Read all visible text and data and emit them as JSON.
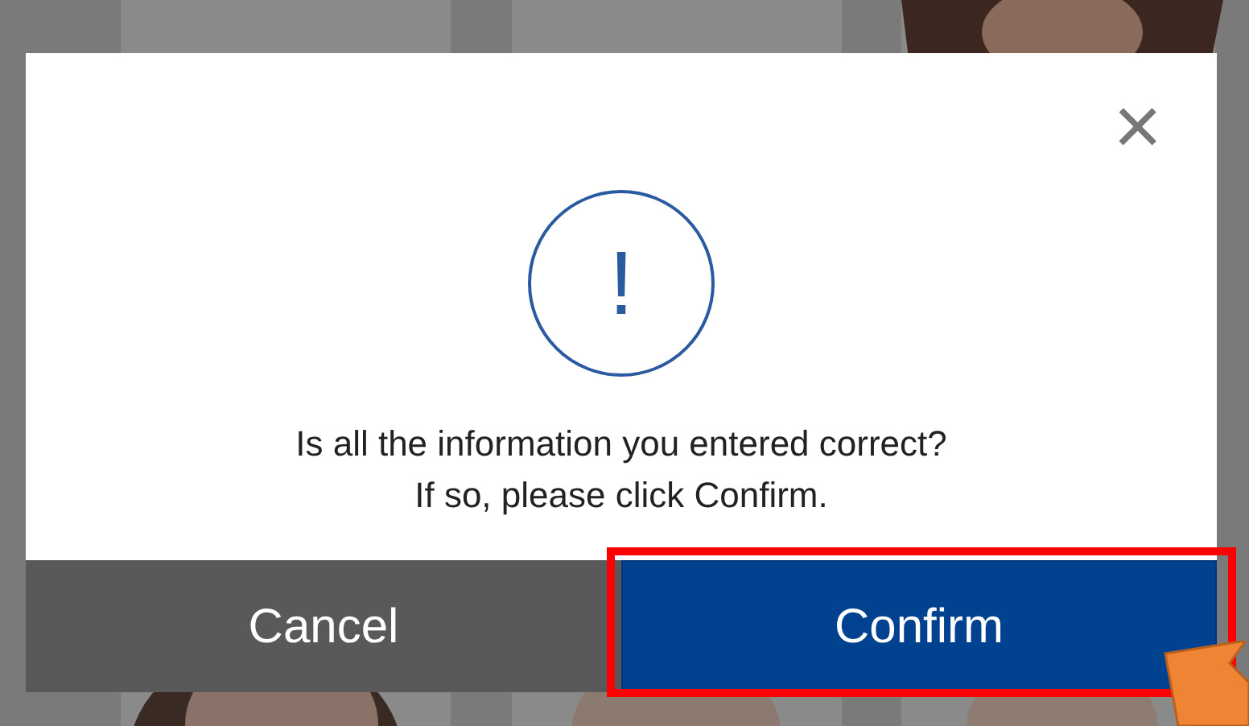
{
  "dialog": {
    "close": "×",
    "icon": "!",
    "message": [
      "Is all the information you entered correct?",
      "If so, please click Confirm."
    ],
    "buttons": [
      {
        "label": "Cancel",
        "kind": "secondary",
        "highlighted": false
      },
      {
        "label": "Confirm",
        "kind": "primary",
        "highlighted": true
      }
    ]
  },
  "pointer_arrow": true
}
